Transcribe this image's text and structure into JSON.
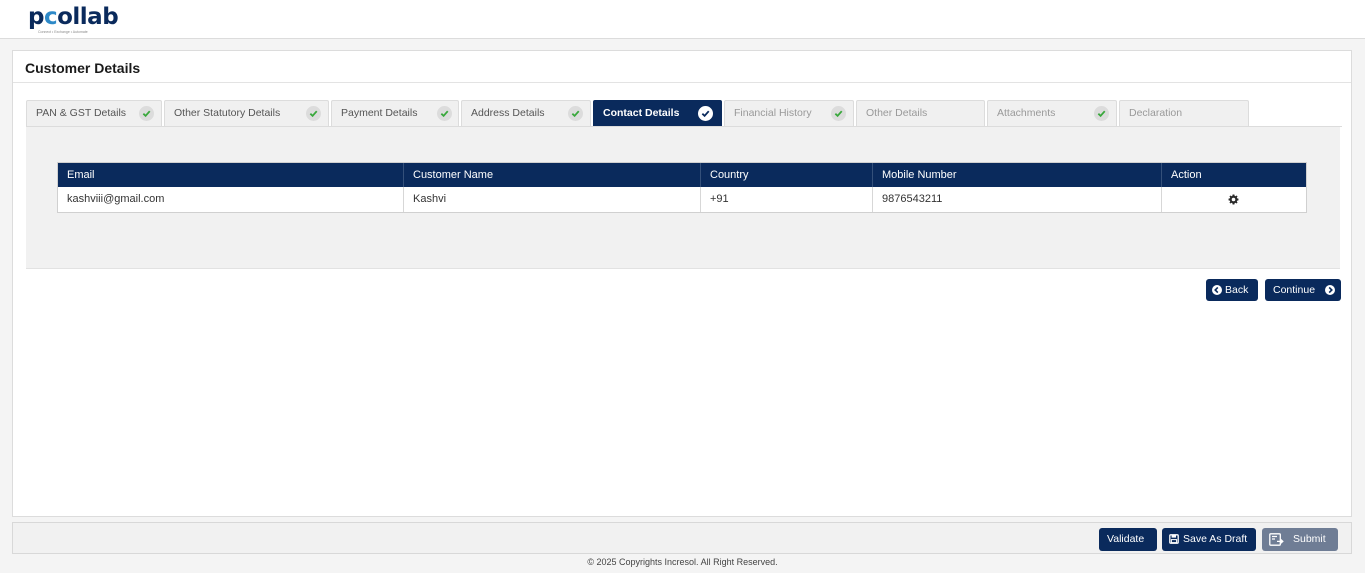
{
  "brand": {
    "logo_text_p": "p",
    "logo_text_c": "c",
    "logo_text_rest": "ollab",
    "tagline": "Connect • Exchange • Automate"
  },
  "page": {
    "title": "Customer Details"
  },
  "tabs": [
    {
      "label": "PAN & GST Details",
      "completed": true,
      "active": false,
      "disabled": false
    },
    {
      "label": "Other Statutory Details",
      "completed": true,
      "active": false,
      "disabled": false
    },
    {
      "label": "Payment Details",
      "completed": true,
      "active": false,
      "disabled": false
    },
    {
      "label": "Address Details",
      "completed": true,
      "active": false,
      "disabled": false
    },
    {
      "label": "Contact Details",
      "completed": true,
      "active": true,
      "disabled": false
    },
    {
      "label": "Financial History",
      "completed": true,
      "active": false,
      "disabled": true
    },
    {
      "label": "Other Details",
      "completed": false,
      "active": false,
      "disabled": true
    },
    {
      "label": "Attachments",
      "completed": true,
      "active": false,
      "disabled": true
    },
    {
      "label": "Declaration",
      "completed": false,
      "active": false,
      "disabled": true
    }
  ],
  "contacts_table": {
    "headers": [
      "Email",
      "Customer Name",
      "Country",
      "Mobile Number",
      "Action"
    ],
    "rows": [
      {
        "email": "kashviii@gmail.com",
        "name": "Kashvi",
        "country": "+91",
        "mobile": "9876543211",
        "action_icon": "gear-icon"
      }
    ]
  },
  "nav_buttons": {
    "back": "Back",
    "continue": "Continue"
  },
  "footer_actions": {
    "validate": "Validate",
    "save_draft": "Save As Draft",
    "submit": "Submit"
  },
  "copyright": "© 2025 Copyrights Incresol. All Right Reserved.",
  "colors": {
    "primary": "#0a2a5c",
    "accent": "#2d89c8",
    "check": "#39a83c",
    "submit_disabled": "#6f7d95"
  }
}
